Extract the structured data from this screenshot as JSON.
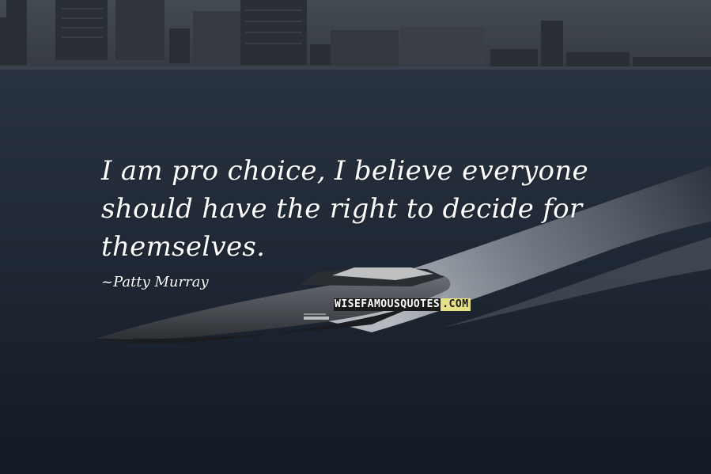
{
  "quote": {
    "lines": [
      "I am pro choice, I believe everyone",
      "should have the right to decide for",
      "themselves."
    ],
    "author": "~Patty Murray"
  },
  "watermark": {
    "part_a": "WISEFAMOUSQUOTES",
    "part_b": ".COM"
  },
  "colors": {
    "sky": "#3b4048",
    "water": "#1b2330",
    "quote_text": "#ffffff",
    "brand_dark": "#1a1a1a",
    "brand_accent": "#e4e083"
  }
}
